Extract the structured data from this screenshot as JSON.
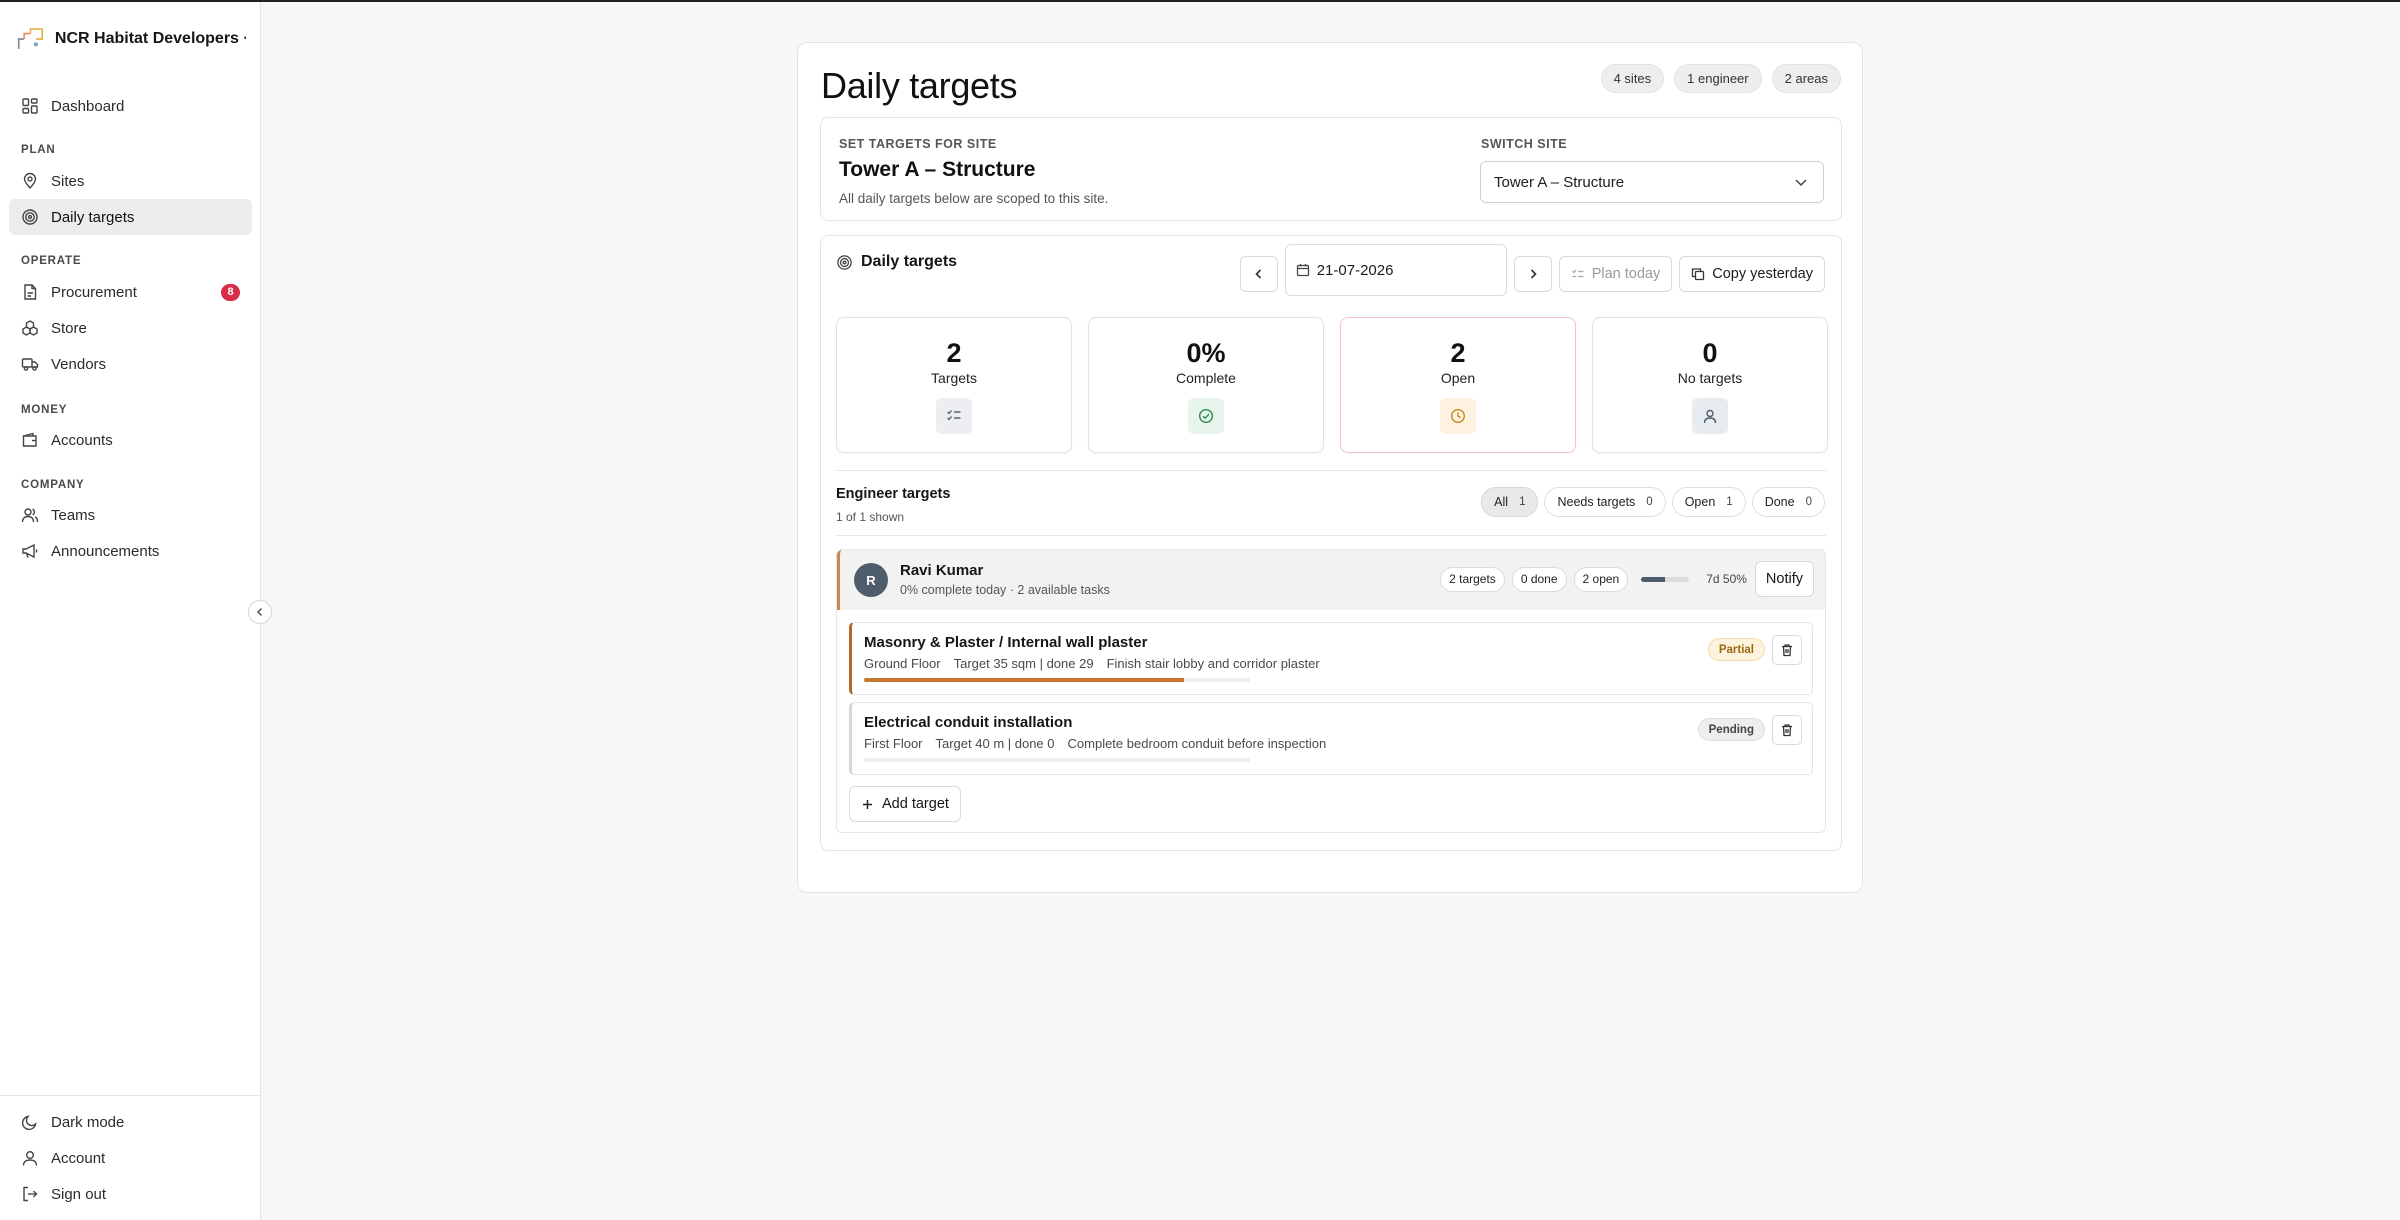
{
  "brand": {
    "name": "NCR Habitat Developers · ..."
  },
  "sidebar": {
    "dashboard": "Dashboard",
    "sections": {
      "plan": "PLAN",
      "operate": "OPERATE",
      "money": "MONEY",
      "company": "COMPANY"
    },
    "items": {
      "sites": "Sites",
      "daily_targets": "Daily targets",
      "procurement": "Procurement",
      "procurement_badge": "8",
      "store": "Store",
      "vendors": "Vendors",
      "accounts": "Accounts",
      "teams": "Teams",
      "announcements": "Announcements"
    },
    "footer": {
      "dark_mode": "Dark mode",
      "account": "Account",
      "sign_out": "Sign out"
    }
  },
  "header": {
    "title": "Daily targets",
    "chips": [
      "4 sites",
      "1 engineer",
      "2 areas"
    ]
  },
  "site_panel": {
    "eyebrow": "SET TARGETS FOR SITE",
    "site_name": "Tower A – Structure",
    "hint": "All daily targets below are scoped to this site.",
    "switch_label": "SWITCH SITE",
    "selected_site": "Tower A – Structure"
  },
  "targets_panel": {
    "title": "Daily targets",
    "date": "21-07-2026",
    "plan_today": "Plan today",
    "copy_yesterday": "Copy yesterday",
    "stats": [
      {
        "value": "2",
        "label": "Targets",
        "icon": "checklist-icon"
      },
      {
        "value": "0%",
        "label": "Complete",
        "icon": "check-circle-icon"
      },
      {
        "value": "2",
        "label": "Open",
        "icon": "clock-icon"
      },
      {
        "value": "0",
        "label": "No targets",
        "icon": "user-icon"
      }
    ],
    "engineer_section": {
      "title": "Engineer targets",
      "subtitle": "1 of 1 shown",
      "filters": [
        {
          "label": "All",
          "count": "1",
          "active": true
        },
        {
          "label": "Needs targets",
          "count": "0",
          "active": false
        },
        {
          "label": "Open",
          "count": "1",
          "active": false
        },
        {
          "label": "Done",
          "count": "0",
          "active": false
        }
      ]
    },
    "engineer": {
      "initial": "R",
      "name": "Ravi Kumar",
      "meta": "0% complete today · 2 available tasks",
      "pills": [
        "2 targets",
        "0 done",
        "2 open"
      ],
      "seven_day_progress": 0.5,
      "seven_day_label": "7d 50%",
      "notify": "Notify",
      "tasks": [
        {
          "title": "Masonry & Plaster / Internal wall plaster",
          "floor": "Ground Floor",
          "target": "Target 35 sqm | done 29",
          "note": "Finish stair lobby and corridor plaster",
          "progress": 0.83,
          "status": "Partial"
        },
        {
          "title": "Electrical conduit installation",
          "floor": "First Floor",
          "target": "Target 40 m | done 0",
          "note": "Complete bedroom conduit before inspection",
          "progress": 0,
          "status": "Pending"
        }
      ],
      "add_target": "Add target"
    }
  },
  "colors": {
    "accent_orange": "#c87730",
    "badge_red": "#d92d4a",
    "avatar": "#4e5d6c",
    "partial_bg": "#fdf3dc",
    "partial_text": "#9a6a12",
    "pending_bg": "#eeeeee"
  }
}
